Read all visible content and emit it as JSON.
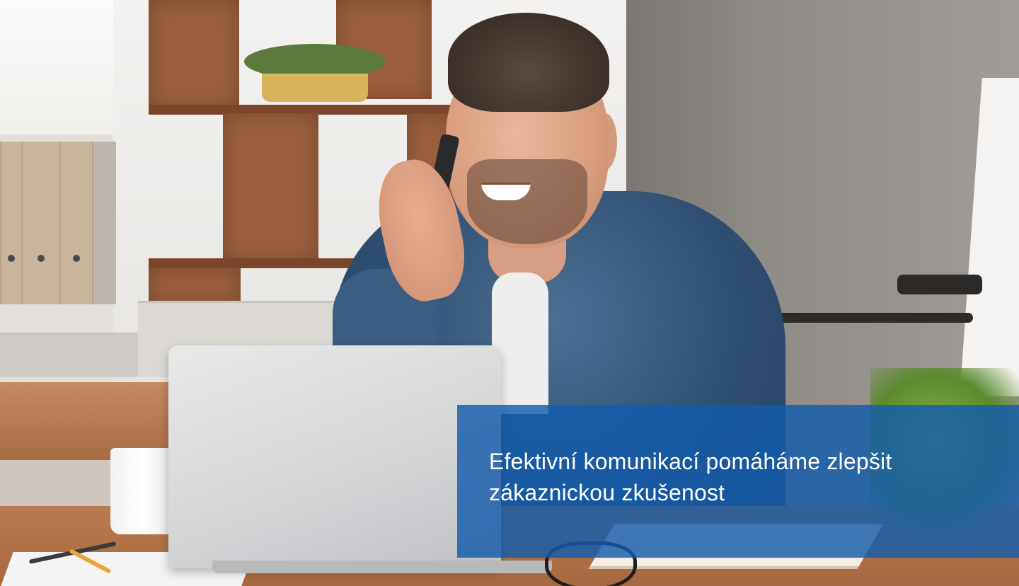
{
  "hero": {
    "image_alt": "Muž telefonuje u notebooku v kanceláři",
    "caption": "Efektivní komunikací pomáháme zlepšit zákaznickou zkušenost"
  },
  "colors": {
    "caption_overlay": "#125cac",
    "caption_text": "#ffffff"
  }
}
